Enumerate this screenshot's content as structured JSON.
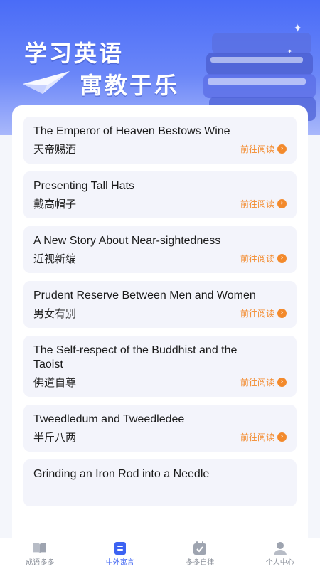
{
  "hero": {
    "title_line1": "学习英语",
    "title_line2": "寓教于乐"
  },
  "stories": [
    {
      "en": "The Emperor of Heaven Bestows Wine",
      "cn": "天帝赐酒",
      "action": "前往阅读"
    },
    {
      "en": "Presenting Tall Hats",
      "cn": "戴高帽子",
      "action": "前往阅读"
    },
    {
      "en": "A New Story About Near-sightedness",
      "cn": "近视新编",
      "action": "前往阅读"
    },
    {
      "en": "Prudent Reserve Between Men and Women",
      "cn": "男女有别",
      "action": "前往阅读"
    },
    {
      "en": "The Self-respect of the Buddhist and the Taoist",
      "cn": "佛道自尊",
      "action": "前往阅读"
    },
    {
      "en": "Tweedledum and Tweedledee",
      "cn": "半斤八两",
      "action": "前往阅读"
    },
    {
      "en": "Grinding an Iron Rod into a Needle",
      "cn": "",
      "action": ""
    }
  ],
  "tabs": [
    {
      "label": "成语多多",
      "icon": "book-open-icon",
      "active": false
    },
    {
      "label": "中外寓言",
      "icon": "document-icon",
      "active": true
    },
    {
      "label": "多多自律",
      "icon": "calendar-check-icon",
      "active": false
    },
    {
      "label": "个人中心",
      "icon": "user-icon",
      "active": false
    }
  ],
  "colors": {
    "primary": "#3d63f2",
    "accent": "#f38a2c",
    "card_bg": "#f3f4fb",
    "inactive": "#8a8f99"
  }
}
